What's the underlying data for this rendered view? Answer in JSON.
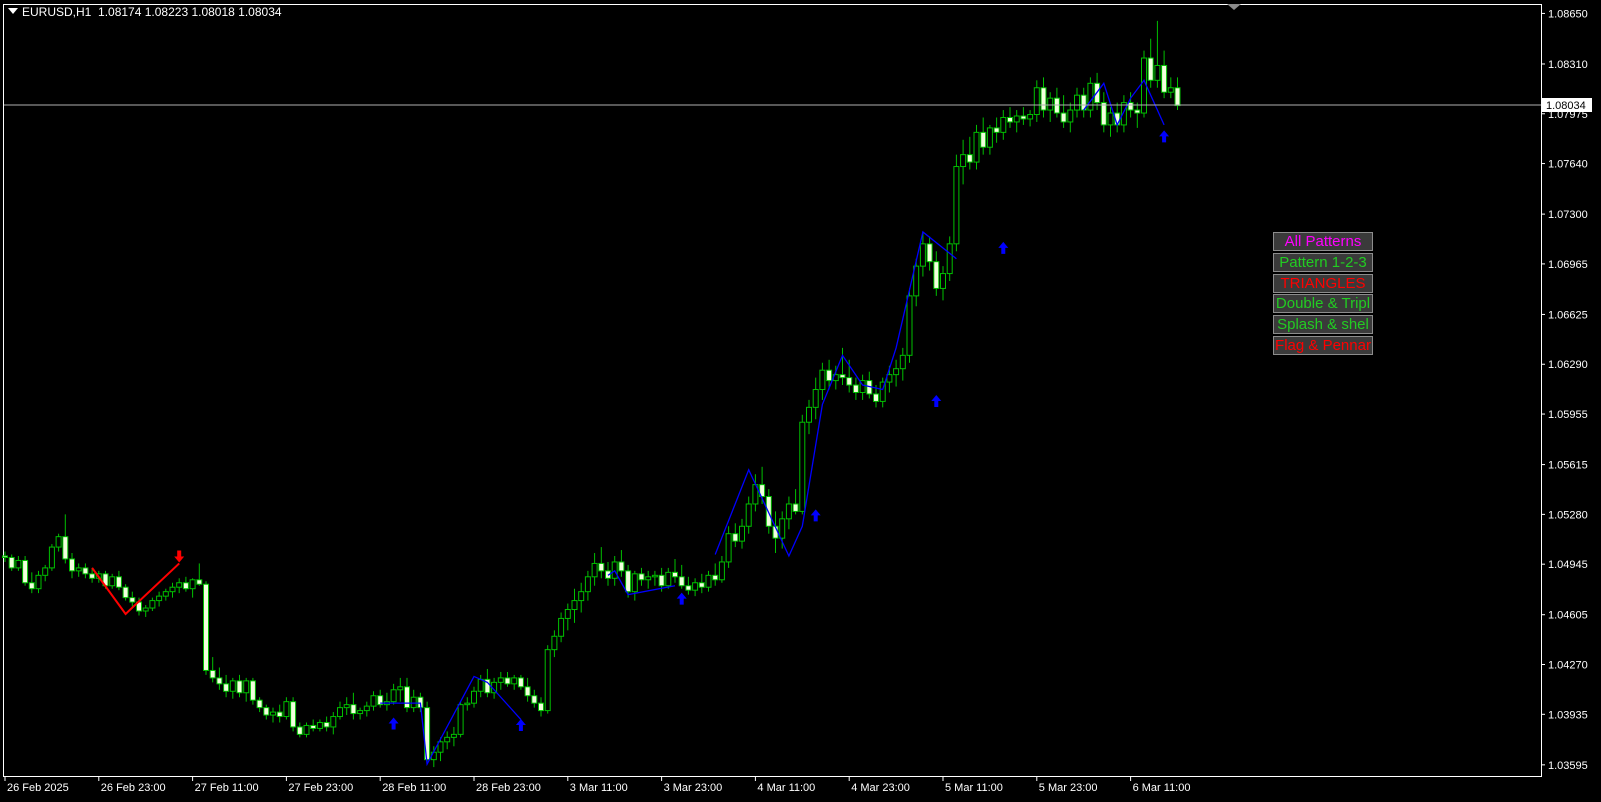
{
  "header": {
    "symbol": "EURUSD,H1",
    "ohlc": "1.08174 1.08223 1.08018 1.08034"
  },
  "price_axis": {
    "labels": [
      "1.08650",
      "1.08310",
      "1.07975",
      "1.07640",
      "1.07300",
      "1.06965",
      "1.06625",
      "1.06290",
      "1.05955",
      "1.05615",
      "1.05280",
      "1.04945",
      "1.04605",
      "1.04270",
      "1.03935",
      "1.03595"
    ],
    "current_price": "1.08034"
  },
  "time_axis": {
    "labels": [
      "26 Feb 2025",
      "26 Feb 23:00",
      "27 Feb 11:00",
      "27 Feb 23:00",
      "28 Feb 11:00",
      "28 Feb 23:00",
      "3 Mar 11:00",
      "3 Mar 23:00",
      "4 Mar 11:00",
      "4 Mar 23:00",
      "5 Mar 11:00",
      "5 Mar 23:00",
      "6 Mar 11:00"
    ]
  },
  "colors": {
    "background": "#000000",
    "foreground": "#ffffff",
    "candle_bull_border": "#00c000",
    "candle_bull_fill": "#000000",
    "candle_bear_fill": "#f2ffde",
    "zigzag_blue": "#0000ff",
    "zigzag_red": "#ff0000",
    "arrow_blue": "#0000ff",
    "arrow_red": "#ff0000",
    "price_line": "#b0b0b0"
  },
  "pattern_panel": {
    "buttons": [
      {
        "label": "All Patterns",
        "color": "#ff00ff"
      },
      {
        "label": "Pattern 1-2-3",
        "color": "#22cc22"
      },
      {
        "label": "TRIANGLES",
        "color": "#ff0000"
      },
      {
        "label": "Double & Tripl",
        "color": "#22cc22"
      },
      {
        "label": "Splash & shel",
        "color": "#22cc22"
      },
      {
        "label": "Flag & Pennar",
        "color": "#ff0000"
      }
    ]
  },
  "chart_data": {
    "type": "candlestick",
    "symbol": "EURUSD",
    "timeframe": "H1",
    "ylim": [
      1.0352,
      1.087
    ],
    "grid": false,
    "candle_ohlc": [
      [
        1.05,
        1.0503,
        1.0496,
        1.0499
      ],
      [
        1.0499,
        1.0501,
        1.049,
        1.0492
      ],
      [
        1.0492,
        1.05,
        1.049,
        1.0497
      ],
      [
        1.0497,
        1.05,
        1.048,
        1.0482
      ],
      [
        1.0482,
        1.0489,
        1.0475,
        1.0478
      ],
      [
        1.0478,
        1.049,
        1.0475,
        1.0487
      ],
      [
        1.0487,
        1.0494,
        1.0483,
        1.0492
      ],
      [
        1.0492,
        1.0508,
        1.049,
        1.0506
      ],
      [
        1.0506,
        1.0515,
        1.0503,
        1.0513
      ],
      [
        1.0513,
        1.0528,
        1.0495,
        1.0498
      ],
      [
        1.0498,
        1.0502,
        1.0485,
        1.049
      ],
      [
        1.049,
        1.0495,
        1.0486,
        1.0492
      ],
      [
        1.0492,
        1.0495,
        1.0485,
        1.0488
      ],
      [
        1.0488,
        1.0492,
        1.0482,
        1.0485
      ],
      [
        1.0485,
        1.049,
        1.0482,
        1.0488
      ],
      [
        1.0488,
        1.049,
        1.0478,
        1.048
      ],
      [
        1.048,
        1.0488,
        1.0478,
        1.0486
      ],
      [
        1.0486,
        1.049,
        1.0477,
        1.0479
      ],
      [
        1.0479,
        1.0481,
        1.047,
        1.0472
      ],
      [
        1.0472,
        1.0476,
        1.0466,
        1.0469
      ],
      [
        1.0469,
        1.0472,
        1.046,
        1.0463
      ],
      [
        1.0463,
        1.0467,
        1.0459,
        1.0465
      ],
      [
        1.0465,
        1.0472,
        1.0463,
        1.047
      ],
      [
        1.047,
        1.0476,
        1.0466,
        1.0473
      ],
      [
        1.0473,
        1.0478,
        1.047,
        1.0476
      ],
      [
        1.0476,
        1.0482,
        1.0472,
        1.0479
      ],
      [
        1.0479,
        1.0485,
        1.0475,
        1.0482
      ],
      [
        1.0482,
        1.0486,
        1.0476,
        1.0478
      ],
      [
        1.0478,
        1.0485,
        1.0472,
        1.0484
      ],
      [
        1.0484,
        1.0495,
        1.048,
        1.0481
      ],
      [
        1.0481,
        1.0483,
        1.042,
        1.0423
      ],
      [
        1.0423,
        1.0432,
        1.0415,
        1.0418
      ],
      [
        1.0418,
        1.0425,
        1.041,
        1.0414
      ],
      [
        1.0414,
        1.042,
        1.0405,
        1.0409
      ],
      [
        1.0409,
        1.0418,
        1.0404,
        1.0416
      ],
      [
        1.0416,
        1.042,
        1.0405,
        1.0408
      ],
      [
        1.0408,
        1.0418,
        1.0402,
        1.0416
      ],
      [
        1.0416,
        1.0418,
        1.04,
        1.0403
      ],
      [
        1.0403,
        1.0405,
        1.0395,
        1.0398
      ],
      [
        1.0398,
        1.04,
        1.039,
        1.0393
      ],
      [
        1.0393,
        1.0398,
        1.0388,
        1.0395
      ],
      [
        1.0395,
        1.04,
        1.0388,
        1.0392
      ],
      [
        1.0392,
        1.0405,
        1.039,
        1.0402
      ],
      [
        1.0402,
        1.0405,
        1.0382,
        1.0385
      ],
      [
        1.0385,
        1.0388,
        1.0378,
        1.038
      ],
      [
        1.038,
        1.0388,
        1.0378,
        1.0386
      ],
      [
        1.0386,
        1.039,
        1.0382,
        1.0384
      ],
      [
        1.0384,
        1.039,
        1.0382,
        1.0388
      ],
      [
        1.0388,
        1.0392,
        1.0382,
        1.0385
      ],
      [
        1.0385,
        1.0395,
        1.038,
        1.0392
      ],
      [
        1.0392,
        1.0402,
        1.039,
        1.0398
      ],
      [
        1.0398,
        1.0405,
        1.0393,
        1.04
      ],
      [
        1.04,
        1.0408,
        1.039,
        1.0394
      ],
      [
        1.0394,
        1.0398,
        1.039,
        1.0396
      ],
      [
        1.0396,
        1.0402,
        1.0392,
        1.0399
      ],
      [
        1.0399,
        1.0409,
        1.0396,
        1.0406
      ],
      [
        1.0406,
        1.041,
        1.0398,
        1.04
      ],
      [
        1.04,
        1.0408,
        1.0396,
        1.0402
      ],
      [
        1.0402,
        1.0414,
        1.04,
        1.041
      ],
      [
        1.041,
        1.0418,
        1.0402,
        1.0412
      ],
      [
        1.0412,
        1.0418,
        1.0395,
        1.0398
      ],
      [
        1.0398,
        1.041,
        1.0395,
        1.0405
      ],
      [
        1.0405,
        1.0408,
        1.0395,
        1.0398
      ],
      [
        1.0398,
        1.0402,
        1.036,
        1.0363
      ],
      [
        1.0363,
        1.0372,
        1.0358,
        1.0368
      ],
      [
        1.0368,
        1.0378,
        1.0362,
        1.0375
      ],
      [
        1.0375,
        1.0382,
        1.037,
        1.0378
      ],
      [
        1.0378,
        1.0385,
        1.0372,
        1.038
      ],
      [
        1.038,
        1.0402,
        1.0378,
        1.04
      ],
      [
        1.04,
        1.0405,
        1.0396,
        1.0401
      ],
      [
        1.0401,
        1.0412,
        1.0398,
        1.0409
      ],
      [
        1.0409,
        1.042,
        1.0405,
        1.0417
      ],
      [
        1.0417,
        1.0424,
        1.0405,
        1.0408
      ],
      [
        1.0408,
        1.0418,
        1.0404,
        1.0415
      ],
      [
        1.0415,
        1.0422,
        1.041,
        1.0418
      ],
      [
        1.0418,
        1.0422,
        1.0412,
        1.0414
      ],
      [
        1.0414,
        1.042,
        1.041,
        1.0418
      ],
      [
        1.0418,
        1.042,
        1.041,
        1.0412
      ],
      [
        1.0412,
        1.0418,
        1.0402,
        1.0406
      ],
      [
        1.0406,
        1.041,
        1.0398,
        1.0401
      ],
      [
        1.0401,
        1.0405,
        1.0392,
        1.0396
      ],
      [
        1.0396,
        1.044,
        1.0394,
        1.0437
      ],
      [
        1.0437,
        1.045,
        1.0432,
        1.0446
      ],
      [
        1.0446,
        1.0462,
        1.0442,
        1.0458
      ],
      [
        1.0458,
        1.0468,
        1.045,
        1.0464
      ],
      [
        1.0464,
        1.0478,
        1.0455,
        1.047
      ],
      [
        1.047,
        1.0482,
        1.0462,
        1.0476
      ],
      [
        1.0476,
        1.049,
        1.047,
        1.0486
      ],
      [
        1.0486,
        1.0502,
        1.048,
        1.0495
      ],
      [
        1.0495,
        1.0506,
        1.0485,
        1.049
      ],
      [
        1.049,
        1.0496,
        1.048,
        1.0485
      ],
      [
        1.0485,
        1.05,
        1.048,
        1.0496
      ],
      [
        1.0496,
        1.0504,
        1.0486,
        1.049
      ],
      [
        1.049,
        1.0494,
        1.0472,
        1.0476
      ],
      [
        1.0476,
        1.049,
        1.047,
        1.0488
      ],
      [
        1.0488,
        1.0492,
        1.048,
        1.0484
      ],
      [
        1.0484,
        1.049,
        1.0478,
        1.0486
      ],
      [
        1.0486,
        1.049,
        1.048,
        1.0487
      ],
      [
        1.0487,
        1.0492,
        1.0476,
        1.048
      ],
      [
        1.048,
        1.0492,
        1.0478,
        1.0489
      ],
      [
        1.0489,
        1.0498,
        1.0482,
        1.0486
      ],
      [
        1.0486,
        1.0494,
        1.0478,
        1.048
      ],
      [
        1.048,
        1.0486,
        1.0474,
        1.0477
      ],
      [
        1.0477,
        1.0485,
        1.0473,
        1.0482
      ],
      [
        1.0482,
        1.0488,
        1.0475,
        1.0479
      ],
      [
        1.0479,
        1.049,
        1.0476,
        1.0487
      ],
      [
        1.0487,
        1.0495,
        1.048,
        1.0484
      ],
      [
        1.0484,
        1.05,
        1.0482,
        1.0496
      ],
      [
        1.0496,
        1.052,
        1.0492,
        1.0515
      ],
      [
        1.0515,
        1.0522,
        1.0506,
        1.051
      ],
      [
        1.051,
        1.0525,
        1.0505,
        1.052
      ],
      [
        1.052,
        1.054,
        1.0515,
        1.0535
      ],
      [
        1.0535,
        1.0555,
        1.053,
        1.0548
      ],
      [
        1.0548,
        1.056,
        1.0535,
        1.054
      ],
      [
        1.054,
        1.0545,
        1.0515,
        1.052
      ],
      [
        1.052,
        1.053,
        1.0502,
        1.0512
      ],
      [
        1.0512,
        1.053,
        1.0505,
        1.0525
      ],
      [
        1.0525,
        1.054,
        1.0518,
        1.0535
      ],
      [
        1.0535,
        1.0545,
        1.0528,
        1.053
      ],
      [
        1.053,
        1.0595,
        1.0528,
        1.059
      ],
      [
        1.059,
        1.0605,
        1.0582,
        1.06
      ],
      [
        1.06,
        1.062,
        1.0592,
        1.0612
      ],
      [
        1.0612,
        1.063,
        1.0605,
        1.0625
      ],
      [
        1.0625,
        1.0632,
        1.0612,
        1.0618
      ],
      [
        1.0618,
        1.0628,
        1.0612,
        1.0622
      ],
      [
        1.0622,
        1.064,
        1.0615,
        1.062
      ],
      [
        1.062,
        1.0632,
        1.061,
        1.0615
      ],
      [
        1.0615,
        1.062,
        1.0605,
        1.061
      ],
      [
        1.061,
        1.0622,
        1.0605,
        1.0618
      ],
      [
        1.0618,
        1.0624,
        1.0606,
        1.0609
      ],
      [
        1.0609,
        1.0615,
        1.06,
        1.0604
      ],
      [
        1.0604,
        1.062,
        1.06,
        1.0617
      ],
      [
        1.0617,
        1.0628,
        1.061,
        1.0622
      ],
      [
        1.0622,
        1.0632,
        1.0614,
        1.0626
      ],
      [
        1.0626,
        1.064,
        1.0618,
        1.0635
      ],
      [
        1.0635,
        1.068,
        1.063,
        1.0675
      ],
      [
        1.0675,
        1.07,
        1.0668,
        1.0695
      ],
      [
        1.0695,
        1.0718,
        1.0688,
        1.071
      ],
      [
        1.071,
        1.0715,
        1.0692,
        1.0698
      ],
      [
        1.0698,
        1.0705,
        1.0675,
        1.068
      ],
      [
        1.068,
        1.0695,
        1.0672,
        1.069
      ],
      [
        1.069,
        1.0715,
        1.0685,
        1.071
      ],
      [
        1.071,
        1.077,
        1.0705,
        1.0762
      ],
      [
        1.0762,
        1.078,
        1.075,
        1.077
      ],
      [
        1.077,
        1.0782,
        1.076,
        1.0765
      ],
      [
        1.0765,
        1.079,
        1.076,
        1.0785
      ],
      [
        1.0785,
        1.0795,
        1.077,
        1.0775
      ],
      [
        1.0775,
        1.079,
        1.077,
        1.0788
      ],
      [
        1.0788,
        1.0795,
        1.0778,
        1.0785
      ],
      [
        1.0785,
        1.08,
        1.078,
        1.0795
      ],
      [
        1.0795,
        1.0802,
        1.0788,
        1.0792
      ],
      [
        1.0792,
        1.08,
        1.0785,
        1.0796
      ],
      [
        1.0796,
        1.0802,
        1.079,
        1.0794
      ],
      [
        1.0794,
        1.08,
        1.0789,
        1.0797
      ],
      [
        1.0797,
        1.082,
        1.0792,
        1.0815
      ],
      [
        1.0815,
        1.0822,
        1.0795,
        1.08
      ],
      [
        1.08,
        1.0812,
        1.0792,
        1.0808
      ],
      [
        1.0808,
        1.0815,
        1.0795,
        1.0798
      ],
      [
        1.0798,
        1.081,
        1.0788,
        1.0792
      ],
      [
        1.0792,
        1.0805,
        1.0785,
        1.08
      ],
      [
        1.08,
        1.0815,
        1.0795,
        1.081
      ],
      [
        1.081,
        1.0815,
        1.0795,
        1.08
      ],
      [
        1.08,
        1.0822,
        1.0795,
        1.0818
      ],
      [
        1.0818,
        1.0825,
        1.08,
        1.0805
      ],
      [
        1.0805,
        1.0812,
        1.0785,
        1.079
      ],
      [
        1.079,
        1.0802,
        1.0782,
        1.0798
      ],
      [
        1.0798,
        1.0805,
        1.0785,
        1.079
      ],
      [
        1.079,
        1.081,
        1.0785,
        1.0805
      ],
      [
        1.0805,
        1.0812,
        1.0795,
        1.08
      ],
      [
        1.08,
        1.0805,
        1.0788,
        1.0798
      ],
      [
        1.0798,
        1.084,
        1.0795,
        1.0835
      ],
      [
        1.0835,
        1.0848,
        1.0815,
        1.082
      ],
      [
        1.082,
        1.086,
        1.0815,
        1.083
      ],
      [
        1.083,
        1.084,
        1.0808,
        1.0812
      ],
      [
        1.0812,
        1.0822,
        1.0808,
        1.0815
      ],
      [
        1.0815,
        1.0822,
        1.08,
        1.0803
      ]
    ],
    "zigzag_lines": [
      {
        "color": "red",
        "points": [
          [
            13,
            1.0492
          ],
          [
            18,
            1.0461
          ],
          [
            26,
            1.0495
          ]
        ]
      },
      {
        "color": "blue",
        "points": [
          [
            56,
            1.0401
          ],
          [
            62,
            1.0401
          ],
          [
            63,
            1.036
          ],
          [
            70,
            1.0419
          ],
          [
            72,
            1.0415
          ],
          [
            77,
            1.039
          ]
        ]
      },
      {
        "color": "blue",
        "points": [
          [
            90,
            1.0487
          ],
          [
            91,
            1.049
          ],
          [
            93,
            1.0474
          ],
          [
            100,
            1.048
          ]
        ]
      },
      {
        "color": "blue",
        "points": [
          [
            106,
            1.0501
          ],
          [
            111,
            1.0558
          ],
          [
            117,
            1.05
          ],
          [
            119,
            1.052
          ],
          [
            122,
            1.0602
          ],
          [
            125,
            1.0635
          ],
          [
            128,
            1.0615
          ],
          [
            131,
            1.0612
          ],
          [
            133,
            1.064
          ],
          [
            137,
            1.0718
          ],
          [
            142,
            1.07
          ]
        ]
      },
      {
        "color": "blue",
        "points": [
          [
            161,
            1.08
          ],
          [
            164,
            1.0818
          ],
          [
            166,
            1.079
          ],
          [
            168,
            1.0808
          ],
          [
            170,
            1.082
          ],
          [
            173,
            1.079
          ]
        ]
      }
    ],
    "arrows": [
      {
        "index": 26,
        "price": 1.0497,
        "direction": "down",
        "color": "red"
      },
      {
        "index": 58,
        "price": 1.039,
        "direction": "up",
        "color": "blue"
      },
      {
        "index": 77,
        "price": 1.0389,
        "direction": "up",
        "color": "blue"
      },
      {
        "index": 101,
        "price": 1.0474,
        "direction": "up",
        "color": "blue"
      },
      {
        "index": 121,
        "price": 1.053,
        "direction": "up",
        "color": "blue"
      },
      {
        "index": 139,
        "price": 1.0607,
        "direction": "up",
        "color": "blue"
      },
      {
        "index": 149,
        "price": 1.071,
        "direction": "up",
        "color": "blue"
      },
      {
        "index": 173,
        "price": 1.0785,
        "direction": "up",
        "color": "blue"
      }
    ]
  }
}
